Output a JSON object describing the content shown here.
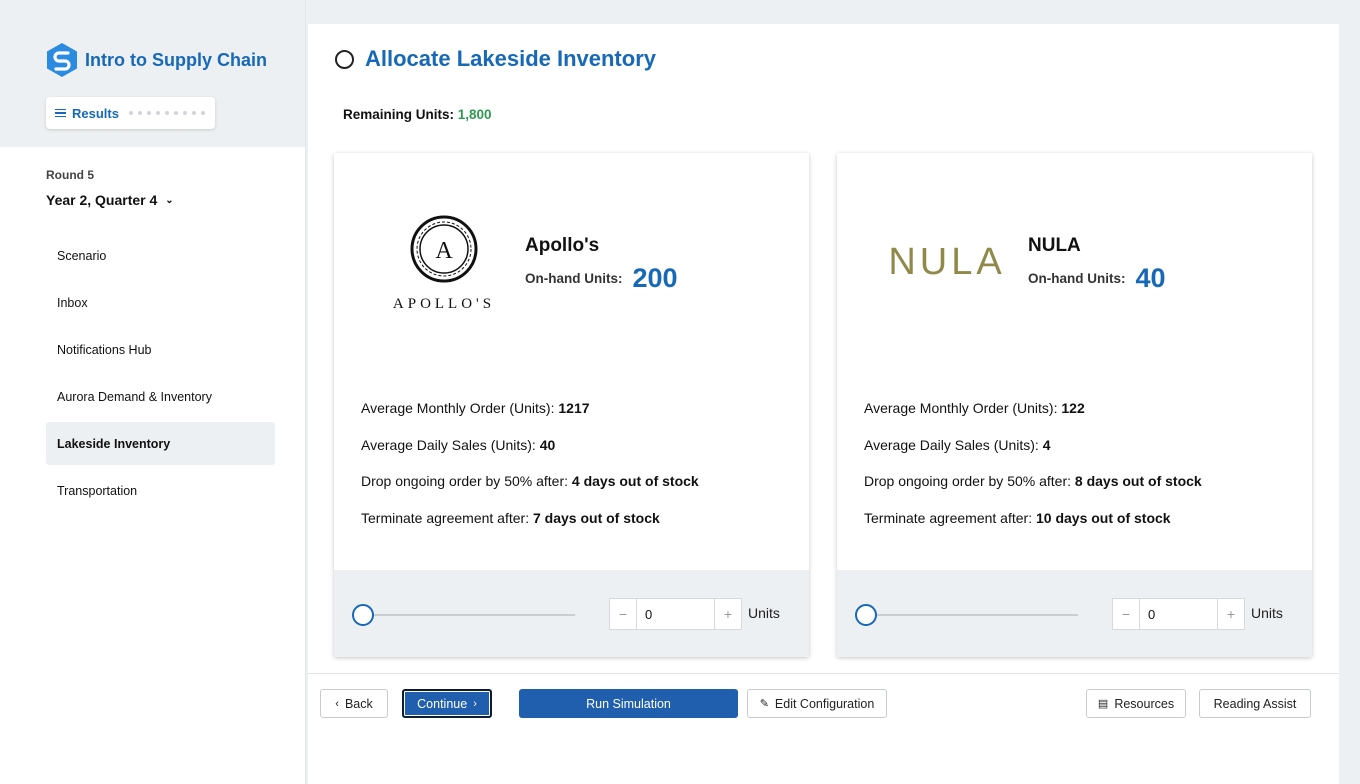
{
  "app": {
    "title": "Intro to Supply Chain",
    "results_label": "Results"
  },
  "sidebar": {
    "round": "Round 5",
    "quarter": "Year 2, Quarter 4",
    "items": [
      {
        "label": "Scenario"
      },
      {
        "label": "Inbox"
      },
      {
        "label": "Notifications Hub"
      },
      {
        "label": "Aurora Demand & Inventory"
      },
      {
        "label": "Lakeside Inventory"
      },
      {
        "label": "Transportation"
      }
    ]
  },
  "main": {
    "title": "Allocate Lakeside Inventory",
    "remaining_label": "Remaining Units:",
    "remaining_value": "1,800"
  },
  "cards": [
    {
      "logo_text": "APOLLO'S",
      "logo_letter": "A",
      "name": "Apollo's",
      "onhand_label": "On-hand Units:",
      "onhand_value": "200",
      "avg_monthly_label": "Average Monthly Order (Units):",
      "avg_monthly_value": "1217",
      "avg_daily_label": "Average Daily Sales (Units):",
      "avg_daily_value": "40",
      "drop_label": "Drop ongoing order by 50% after:",
      "drop_value": "4 days out of stock",
      "terminate_label": "Terminate agreement after:",
      "terminate_value": "7 days out of stock",
      "quantity": "0",
      "units_label": "Units",
      "slider_level": 0
    },
    {
      "logo_text": "NULA",
      "name": "NULA",
      "onhand_label": "On-hand Units:",
      "onhand_value": "40",
      "avg_monthly_label": "Average Monthly Order (Units):",
      "avg_monthly_value": "122",
      "avg_daily_label": "Average Daily Sales (Units):",
      "avg_daily_value": "4",
      "drop_label": "Drop ongoing order by 50% after:",
      "drop_value": "8 days out of stock",
      "terminate_label": "Terminate agreement after:",
      "terminate_value": "10 days out of stock",
      "quantity": "0",
      "units_label": "Units",
      "slider_level": 0
    }
  ],
  "footer": {
    "back": "Back",
    "continue": "Continue",
    "run": "Run Simulation",
    "edit": "Edit Configuration",
    "resources": "Resources",
    "reading": "Reading Assist"
  },
  "colors": {
    "accent": "#1769b8",
    "positive": "#2e9b4f",
    "nula_gold": "#8f8a4a"
  }
}
